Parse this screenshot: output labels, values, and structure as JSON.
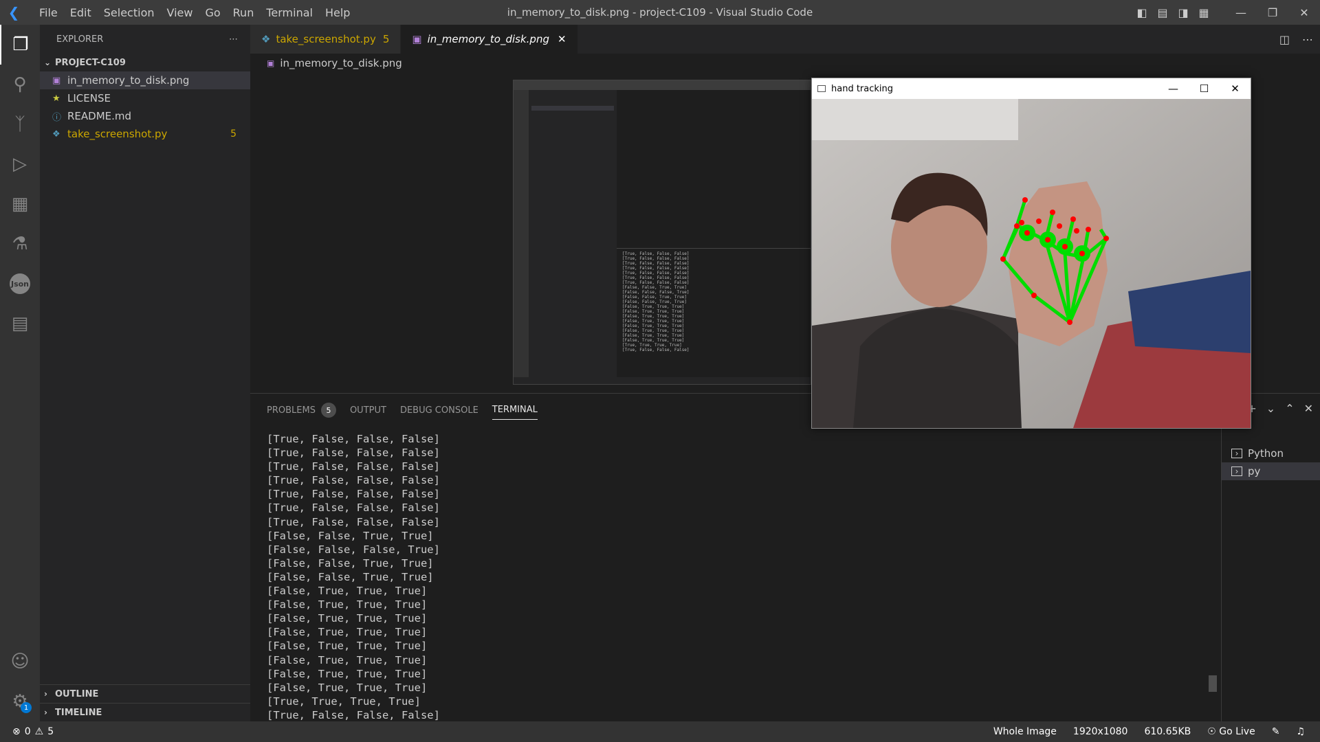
{
  "window": {
    "title": "in_memory_to_disk.png - project-C109 - Visual Studio Code",
    "menu": [
      "File",
      "Edit",
      "Selection",
      "View",
      "Go",
      "Run",
      "Terminal",
      "Help"
    ]
  },
  "sidebar": {
    "title": "EXPLORER",
    "project": "PROJECT-C109",
    "files": [
      {
        "name": "in_memory_to_disk.png",
        "icon": "image-file-icon"
      },
      {
        "name": "LICENSE",
        "icon": "license-icon"
      },
      {
        "name": "README.md",
        "icon": "info-icon"
      },
      {
        "name": "take_screenshot.py",
        "icon": "python-icon",
        "badge": "5"
      }
    ],
    "outline": "OUTLINE",
    "timeline": "TIMELINE"
  },
  "tabs": [
    {
      "label": "take_screenshot.py",
      "badge": "5"
    },
    {
      "label": "in_memory_to_disk.png"
    }
  ],
  "breadcrumb": "in_memory_to_disk.png",
  "panel": {
    "tabs": [
      "PROBLEMS",
      "OUTPUT",
      "DEBUG CONSOLE",
      "TERMINAL"
    ],
    "problems_count": "5",
    "terminal_lines": [
      "[True, False, False, False]",
      "[True, False, False, False]",
      "[True, False, False, False]",
      "[True, False, False, False]",
      "[True, False, False, False]",
      "[True, False, False, False]",
      "[True, False, False, False]",
      "[False, False, True, True]",
      "[False, False, False, True]",
      "[False, False, True, True]",
      "[False, False, True, True]",
      "[False, True, True, True]",
      "[False, True, True, True]",
      "[False, True, True, True]",
      "[False, True, True, True]",
      "[False, True, True, True]",
      "[False, True, True, True]",
      "[False, True, True, True]",
      "[False, True, True, True]",
      "[True, True, True, True]",
      "[True, False, False, False]"
    ],
    "terminal_list": [
      "Python",
      "py"
    ]
  },
  "hand_window": {
    "title": "hand tracking"
  },
  "status": {
    "errors": "0",
    "warnings": "5",
    "whole_image": "Whole Image",
    "resolution": "1920x1080",
    "size": "610.65KB",
    "go_live": "Go Live"
  }
}
